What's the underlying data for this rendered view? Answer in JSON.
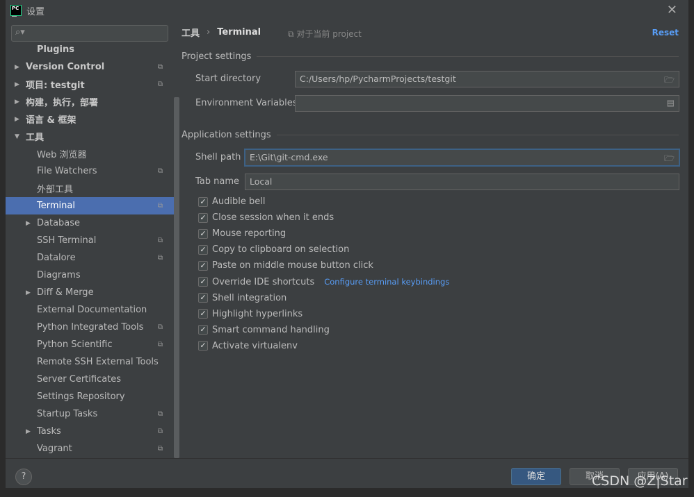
{
  "window": {
    "title": "设置",
    "logo": "PC"
  },
  "search": {
    "placeholder": "",
    "icon": "search-icon"
  },
  "tree": [
    {
      "label": "Plugins",
      "level": 1,
      "bold": true,
      "arrow": false,
      "copy": false
    },
    {
      "label": "Version Control",
      "level": 0,
      "bold": true,
      "arrow": true,
      "copy": true
    },
    {
      "label": "项目: testgit",
      "level": 0,
      "bold": true,
      "arrow": true,
      "copy": true
    },
    {
      "label": "构建，执行，部署",
      "level": 0,
      "bold": true,
      "arrow": true,
      "copy": false
    },
    {
      "label": "语言 & 框架",
      "level": 0,
      "bold": true,
      "arrow": true,
      "copy": false
    },
    {
      "label": "工具",
      "level": 0,
      "bold": true,
      "arrow": "open",
      "copy": false
    },
    {
      "label": "Web 浏览器",
      "level": 1,
      "copy": false
    },
    {
      "label": "File Watchers",
      "level": 1,
      "copy": true
    },
    {
      "label": "外部工具",
      "level": 1,
      "copy": false
    },
    {
      "label": "Terminal",
      "level": 1,
      "copy": true,
      "selected": true
    },
    {
      "label": "Database",
      "level": 1,
      "arrow": true,
      "copy": false
    },
    {
      "label": "SSH Terminal",
      "level": 1,
      "copy": true
    },
    {
      "label": "Datalore",
      "level": 1,
      "copy": true
    },
    {
      "label": "Diagrams",
      "level": 1,
      "copy": false
    },
    {
      "label": "Diff & Merge",
      "level": 1,
      "arrow": true,
      "copy": false
    },
    {
      "label": "External Documentation",
      "level": 1,
      "copy": false
    },
    {
      "label": "Python Integrated Tools",
      "level": 1,
      "copy": true
    },
    {
      "label": "Python Scientific",
      "level": 1,
      "copy": true
    },
    {
      "label": "Remote SSH External Tools",
      "level": 1,
      "copy": false
    },
    {
      "label": "Server Certificates",
      "level": 1,
      "copy": false
    },
    {
      "label": "Settings Repository",
      "level": 1,
      "copy": false
    },
    {
      "label": "Startup Tasks",
      "level": 1,
      "copy": true
    },
    {
      "label": "Tasks",
      "level": 1,
      "arrow": true,
      "copy": true
    },
    {
      "label": "Vagrant",
      "level": 1,
      "copy": true
    }
  ],
  "breadcrumb": {
    "parent": "工具",
    "sep": "›",
    "current": "Terminal",
    "scope": "对于当前 project",
    "reset": "Reset"
  },
  "project_settings": {
    "title": "Project settings",
    "start_dir_label": "Start directory",
    "start_dir": "C:/Users/hp/PycharmProjects/testgit",
    "env_label": "Environment Variables",
    "env": ""
  },
  "app_settings": {
    "title": "Application settings",
    "shell_label": "Shell path",
    "shell": "E:\\Git\\git-cmd.exe",
    "tab_label": "Tab name",
    "tab": "Local"
  },
  "checkboxes": [
    {
      "label": "Audible bell",
      "checked": true
    },
    {
      "label": "Close session when it ends",
      "checked": true
    },
    {
      "label": "Mouse reporting",
      "checked": true
    },
    {
      "label": "Copy to clipboard on selection",
      "checked": true
    },
    {
      "label": "Paste on middle mouse button click",
      "checked": true
    },
    {
      "label": "Override IDE shortcuts",
      "checked": true,
      "link": "Configure terminal keybindings"
    },
    {
      "label": "Shell integration",
      "checked": true
    },
    {
      "label": "Highlight hyperlinks",
      "checked": true
    },
    {
      "label": "Smart command handling",
      "checked": true
    },
    {
      "label": "Activate virtualenv",
      "checked": true
    }
  ],
  "footer": {
    "help": "?",
    "ok": "确定",
    "cancel": "取消",
    "apply": "应用(A)"
  },
  "watermark": "CSDN @Z|Star",
  "colors": {
    "selection": "#4b6eaf",
    "link": "#589df6",
    "primary_button": "#365880"
  }
}
